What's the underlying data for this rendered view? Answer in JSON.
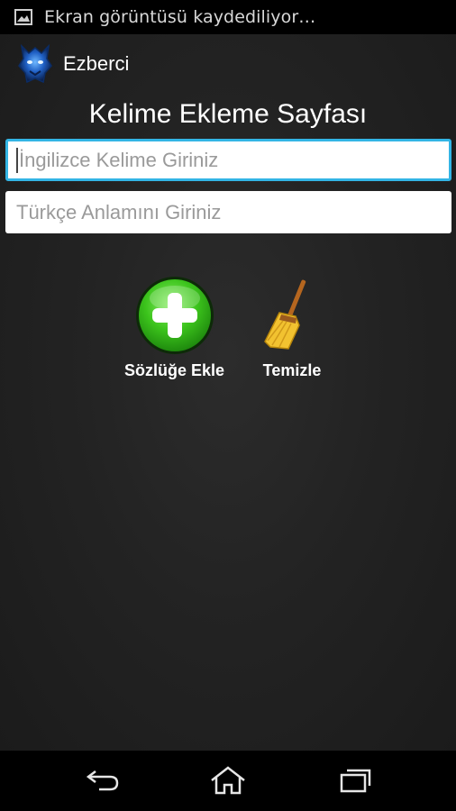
{
  "status_bar": {
    "notification_text": "Ekran görüntüsü kaydediliyor…",
    "icon": "image-icon"
  },
  "app": {
    "title": "Ezberci",
    "logo_icon": "app-logo-icon"
  },
  "page": {
    "title": "Kelime Ekleme Sayfası"
  },
  "form": {
    "english_word": {
      "value": "",
      "placeholder": "İngilizce Kelime Giriniz"
    },
    "turkish_meaning": {
      "value": "",
      "placeholder": "Türkçe Anlamını Giriniz"
    }
  },
  "actions": {
    "add": {
      "label": "Sözlüğe Ekle",
      "icon": "plus-circle-icon"
    },
    "clear": {
      "label": "Temizle",
      "icon": "broom-icon"
    }
  },
  "nav": {
    "back_icon": "back-icon",
    "home_icon": "home-icon",
    "recents_icon": "recents-icon"
  },
  "colors": {
    "focus_accent": "#33b5e5",
    "add_green": "#3cc41c"
  }
}
